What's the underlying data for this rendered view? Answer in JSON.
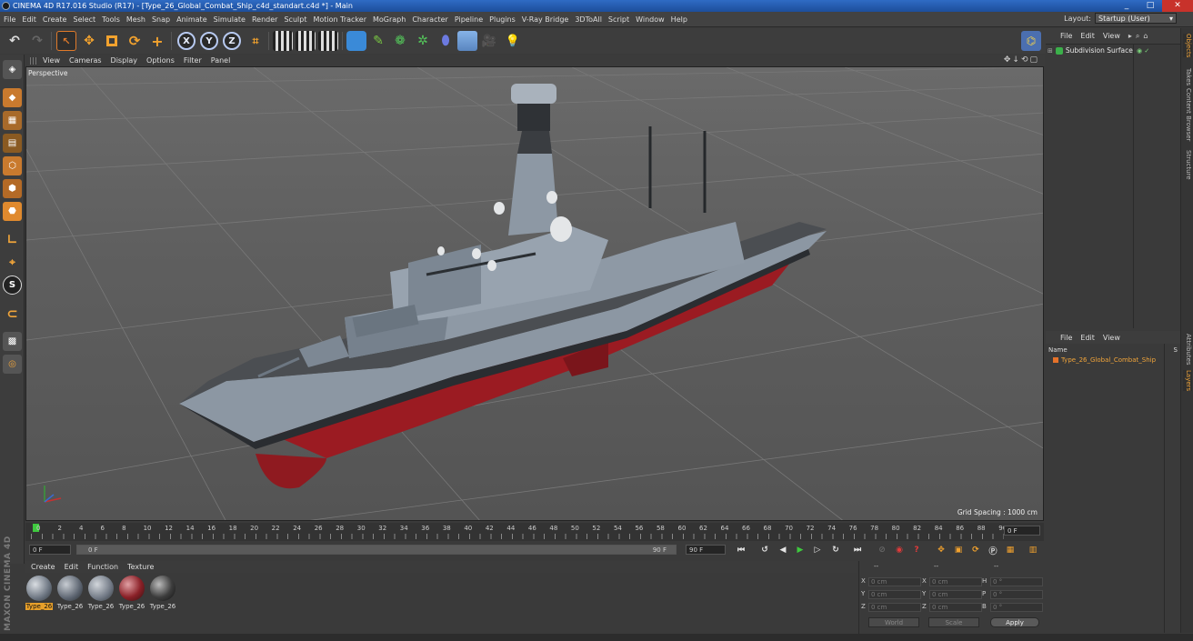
{
  "window": {
    "title": "CINEMA 4D R17.016 Studio (R17) - [Type_26_Global_Combat_Ship_c4d_standart.c4d *] - Main",
    "buttons": [
      "_",
      "□",
      "✕"
    ]
  },
  "menu": [
    "File",
    "Edit",
    "Create",
    "Select",
    "Tools",
    "Mesh",
    "Snap",
    "Animate",
    "Simulate",
    "Render",
    "Sculpt",
    "Motion Tracker",
    "MoGraph",
    "Character",
    "Pipeline",
    "Plugins",
    "V-Ray Bridge",
    "3DToAll",
    "Script",
    "Window",
    "Help"
  ],
  "layout": {
    "label": "Layout:",
    "value": "Startup (User)"
  },
  "toolbar": {
    "axis_x": "X",
    "axis_y": "Y",
    "axis_z": "Z"
  },
  "viewport": {
    "menu": [
      "View",
      "Cameras",
      "Display",
      "Options",
      "Filter",
      "Panel"
    ],
    "label": "Perspective",
    "grid_spacing": "Grid Spacing : 1000 cm"
  },
  "timeline": {
    "ticks": [
      "0",
      "2",
      "4",
      "6",
      "8",
      "10",
      "12",
      "14",
      "16",
      "18",
      "20",
      "22",
      "24",
      "26",
      "28",
      "30",
      "32",
      "34",
      "36",
      "38",
      "40",
      "42",
      "44",
      "46",
      "48",
      "50",
      "52",
      "54",
      "56",
      "58",
      "60",
      "62",
      "64",
      "66",
      "68",
      "70",
      "72",
      "74",
      "76",
      "78",
      "80",
      "82",
      "84",
      "86",
      "88",
      "90"
    ],
    "current_frame": "0 F"
  },
  "transport": {
    "start": "0 F",
    "range_start": "0 F",
    "range_end": "90 F",
    "end": "90 F"
  },
  "materials": {
    "menu": [
      "Create",
      "Edit",
      "Function",
      "Texture"
    ],
    "items": [
      {
        "name": "Type_26",
        "selected": true
      },
      {
        "name": "Type_26",
        "selected": false
      },
      {
        "name": "Type_26",
        "selected": false
      },
      {
        "name": "Type_26",
        "selected": false
      },
      {
        "name": "Type_26",
        "selected": false
      }
    ]
  },
  "coordinates": {
    "header": [
      "--",
      "--",
      "--"
    ],
    "rows": [
      {
        "a": "X",
        "av": "0 cm",
        "b": "X",
        "bv": "0 cm",
        "c": "H",
        "cv": "0 °"
      },
      {
        "a": "Y",
        "av": "0 cm",
        "b": "Y",
        "bv": "0 cm",
        "c": "P",
        "cv": "0 °"
      },
      {
        "a": "Z",
        "av": "0 cm",
        "b": "Z",
        "bv": "0 cm",
        "c": "B",
        "cv": "0 °"
      }
    ],
    "mode": "World",
    "transform": "Scale",
    "apply": "Apply"
  },
  "object_manager": {
    "menu": [
      "File",
      "Edit",
      "View"
    ],
    "object": "Subdivision Surface"
  },
  "layer_manager": {
    "menu": [
      "File",
      "Edit",
      "View"
    ],
    "col_name": "Name",
    "col_s": "S",
    "layer": "Type_26_Global_Combat_Ship"
  },
  "side_tabs": [
    "Objects",
    "Takes",
    "Content Browser",
    "Structure",
    "Attributes",
    "Layers"
  ],
  "maxon": "MAXON CINEMA 4D",
  "colors": {
    "accent": "#f0a43a",
    "title_bar": "#1d4e9b",
    "hull": "#8f9aa6",
    "waterline": "#9b1b22"
  }
}
